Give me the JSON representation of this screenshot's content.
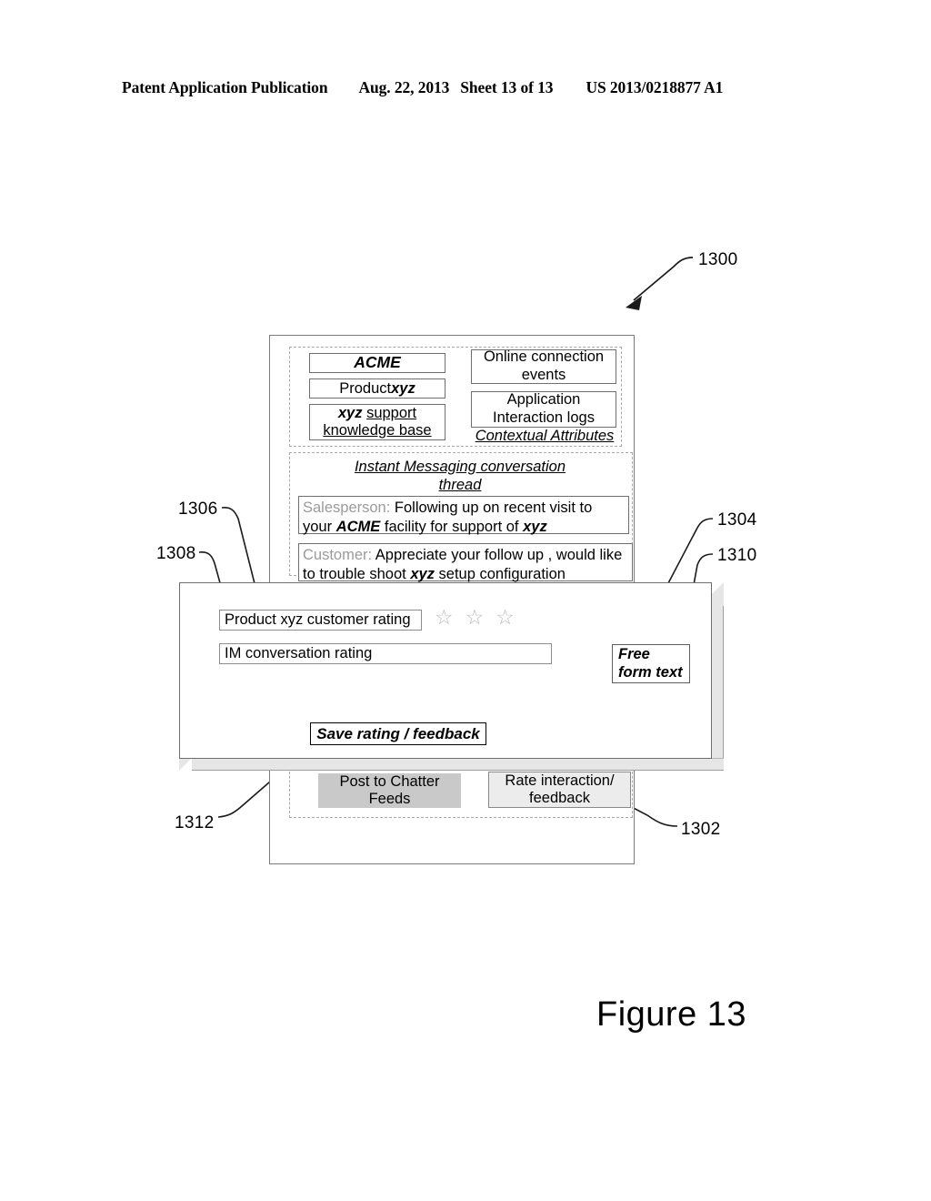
{
  "header": {
    "publication": "Patent Application Publication",
    "date": "Aug. 22, 2013",
    "sheet": "Sheet 13 of 13",
    "number": "US 2013/0218877 A1"
  },
  "figure": {
    "caption": "Figure 13"
  },
  "reference_numerals": {
    "overall": "1300",
    "app_window": "1302",
    "rating_dialog": "1304",
    "product_rating_field": "1306",
    "im_rating_field": "1308",
    "free_form_text": "1310",
    "save_button": "1312"
  },
  "contextual_attributes": {
    "section_label": "Contextual Attributes",
    "left_column": [
      {
        "name": "account",
        "text": "ACME"
      },
      {
        "name": "product",
        "prefix": "Product ",
        "emphasis": "xyz"
      },
      {
        "name": "knowledge-base",
        "line1_bold": "xyz ",
        "line1_underline": "support",
        "line2": "knowledge base"
      }
    ],
    "right_column": [
      {
        "name": "online-connection-events",
        "line1": "Online connection",
        "line2": "events"
      },
      {
        "name": "application-interaction-logs",
        "line1": "Application",
        "line2": "Interaction logs"
      }
    ]
  },
  "im_thread": {
    "title_line1": "Instant Messaging conversation",
    "title_line2": "thread",
    "messages": [
      {
        "speaker": "Salesperson:",
        "text_part1": " Following up on recent visit to your ",
        "emphasis1": "ACME",
        "text_part2": " facility for support of ",
        "emphasis2": "xyz"
      },
      {
        "speaker": "Customer:",
        "text_part1": " Appreciate your follow up , would like to trouble shoot ",
        "emphasis1": "xyz",
        "text_part2": " setup configuration"
      }
    ]
  },
  "action_buttons": [
    {
      "name": "post-to-chatter-feeds",
      "line1": "Post to Chatter",
      "line2": "Feeds",
      "fill": "#c9c9c9"
    },
    {
      "name": "rate-interaction-feedback",
      "line1": "Rate interaction/",
      "line2": "feedback",
      "fill": "#ececec"
    }
  ],
  "rating_dialog": {
    "product_rating_label": "Product xyz customer rating",
    "stars": {
      "count": 3,
      "glyph": "☆",
      "color": "#b9b9b9"
    },
    "im_rating_label": "IM conversation rating",
    "free_form_text_line1": "Free",
    "free_form_text_line2": "form text",
    "save_button_label": "Save rating / feedback"
  }
}
